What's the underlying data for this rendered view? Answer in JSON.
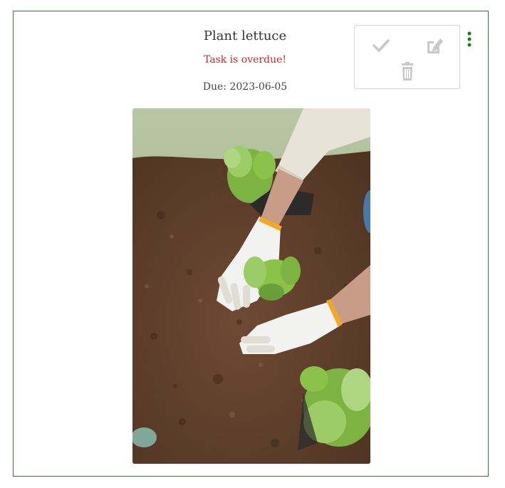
{
  "task": {
    "title": "Plant lettuce",
    "status_message": "Task is overdue!",
    "due_label": "Due:",
    "due_date": "2023-06-05",
    "due_text": "Due: 2023-06-05"
  },
  "photo": {
    "subject": "gloved hands planting lettuce seedlings in soil"
  },
  "menu": {
    "toggle_icon": "vertical-ellipsis-icon",
    "actions": [
      {
        "name": "complete",
        "icon": "checkmark-icon"
      },
      {
        "name": "edit",
        "icon": "edit-icon"
      },
      {
        "name": "delete",
        "icon": "trash-icon"
      }
    ]
  },
  "colors": {
    "border": "#2e7d32",
    "overdue": "#c62828",
    "kebab": "#1b7a1b",
    "action_icon": "#c8c8c8"
  }
}
